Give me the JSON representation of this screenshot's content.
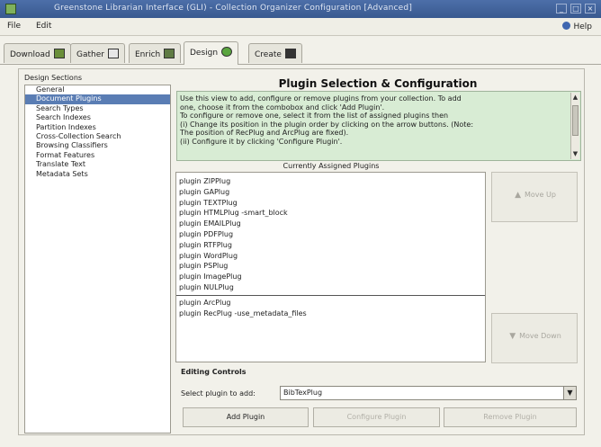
{
  "window": {
    "title": "Greenstone Librarian Interface (GLI) - Collection Organizer Configuration [Advanced]"
  },
  "menu": {
    "file": "File",
    "edit": "Edit",
    "help": "Help"
  },
  "tabs": [
    {
      "label": "Download"
    },
    {
      "label": "Gather"
    },
    {
      "label": "Enrich"
    },
    {
      "label": "Design"
    },
    {
      "label": "Create"
    }
  ],
  "design_sections": {
    "label": "Design Sections",
    "items": [
      "General",
      "Document Plugins",
      "Search Types",
      "Search Indexes",
      "Partition Indexes",
      "Cross-Collection Search",
      "Browsing Classifiers",
      "Format Features",
      "Translate Text",
      "Metadata Sets"
    ],
    "selected_index": 1
  },
  "main": {
    "title": "Plugin Selection & Configuration",
    "help_lines": [
      "Use this view to add, configure or remove plugins from your collection. To add",
      "one, choose it from the combobox and click 'Add Plugin'.",
      "To configure or remove one, select it from the list of assigned plugins then",
      "(i) Change its position in the plugin order by clicking on the arrow buttons. (Note:",
      "The position of RecPlug and ArcPlug are fixed).",
      "(ii) Configure it by clicking 'Configure Plugin'."
    ],
    "list_heading": "Currently Assigned Plugins",
    "plugins_top": [
      "plugin ZIPPlug",
      "plugin GAPlug",
      "plugin TEXTPlug",
      "plugin HTMLPlug -smart_block",
      "plugin EMAILPlug",
      "plugin PDFPlug",
      "plugin RTFPlug",
      "plugin WordPlug",
      "plugin PSPlug",
      "plugin ImagePlug",
      "plugin NULPlug"
    ],
    "plugins_bottom": [
      "plugin ArcPlug",
      "plugin RecPlug -use_metadata_files"
    ],
    "move_up": "Move Up",
    "move_down": "Move Down",
    "editing_heading": "Editing Controls",
    "select_label": "Select plugin to add:",
    "select_value": "BibTexPlug",
    "add_button": "Add Plugin",
    "configure_button": "Configure Plugin",
    "remove_button": "Remove Plugin"
  }
}
